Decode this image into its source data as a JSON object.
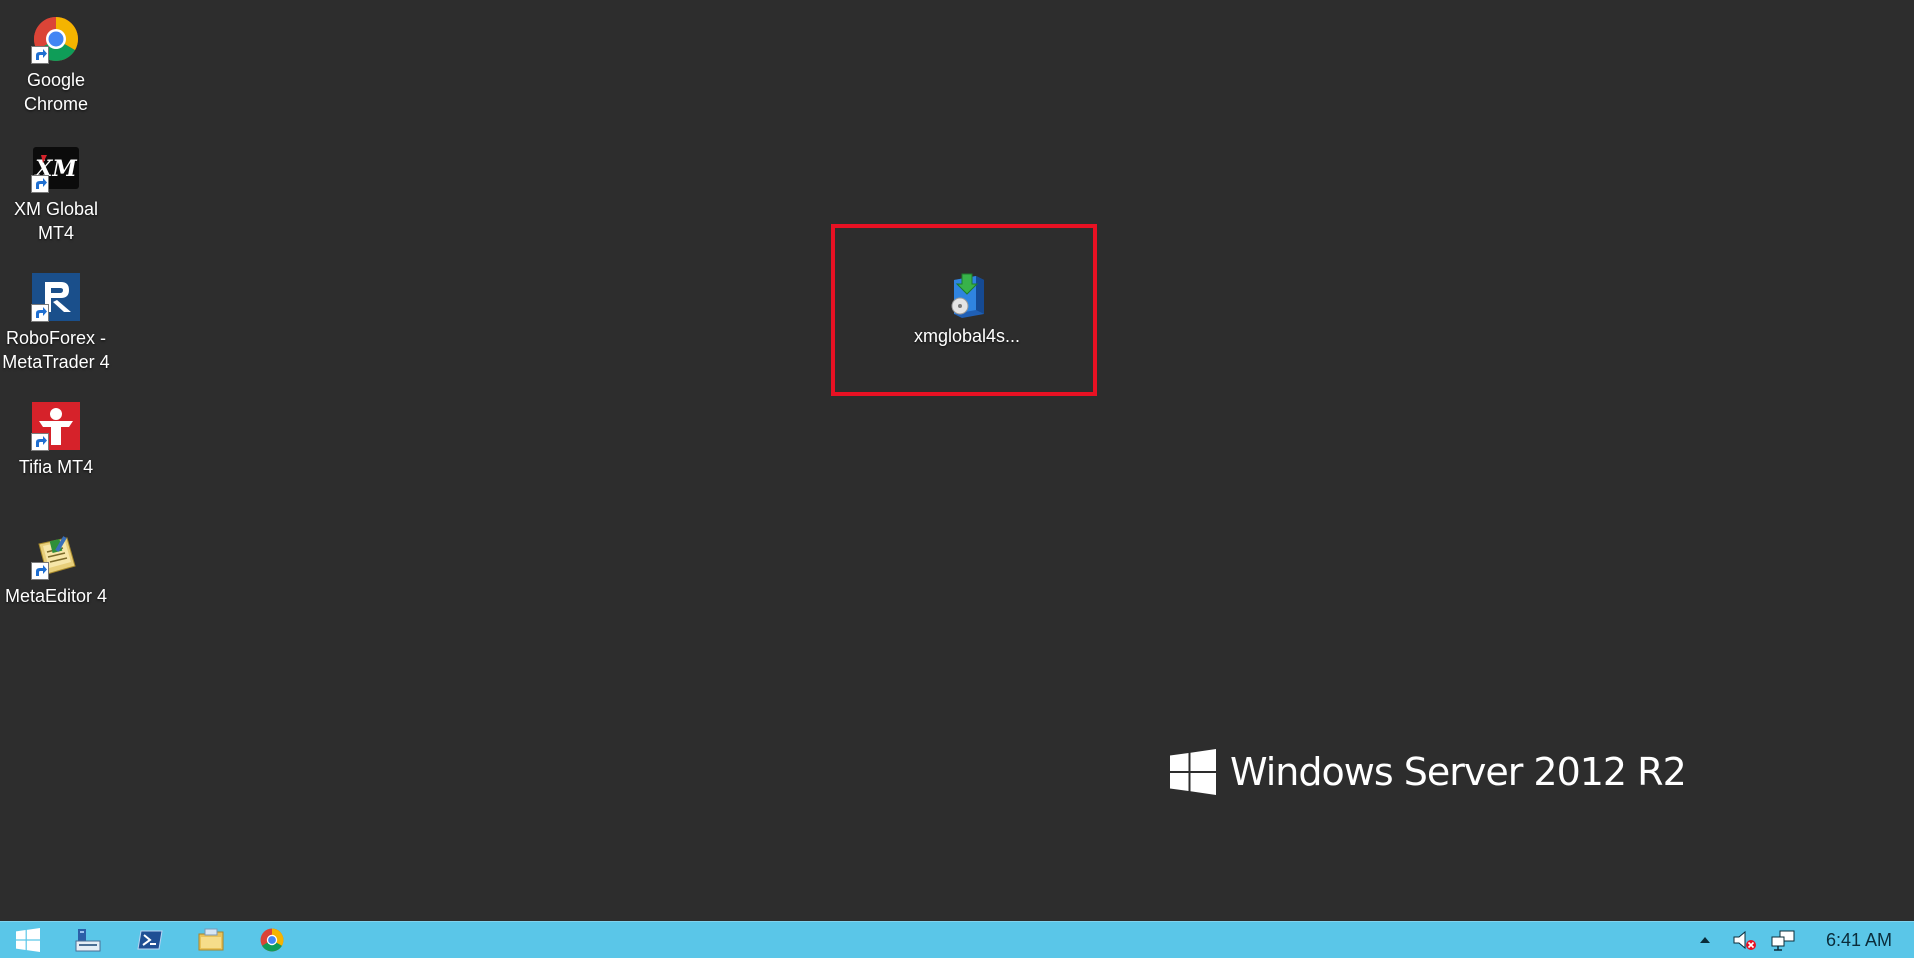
{
  "desktop": {
    "icons": [
      {
        "label_line1": "Google",
        "label_line2": "Chrome",
        "icon": "chrome-icon"
      },
      {
        "label_line1": "XM Global",
        "label_line2": "MT4",
        "icon": "xm-icon"
      },
      {
        "label_line1": "RoboForex -",
        "label_line2": "MetaTrader 4",
        "icon": "roboforex-icon"
      },
      {
        "label_line1": "Tifia MT4",
        "label_line2": "",
        "icon": "tifia-icon"
      },
      {
        "label_line1": "MetaEditor 4",
        "label_line2": "",
        "icon": "metaeditor-icon"
      }
    ],
    "installer": {
      "label": "xmglobal4s...",
      "icon": "installer-icon"
    },
    "brand": {
      "text": "Windows Server 2012 R2"
    }
  },
  "colors": {
    "desktop_bg": "#2d2d2d",
    "taskbar_bg": "#5ac6e8",
    "highlight": "#e81123"
  },
  "taskbar": {
    "pinned": [
      {
        "icon": "start-icon"
      },
      {
        "icon": "server-manager-icon"
      },
      {
        "icon": "powershell-icon"
      },
      {
        "icon": "file-explorer-icon"
      },
      {
        "icon": "chrome-icon"
      }
    ],
    "tray": {
      "clock": "6:41 AM",
      "icons": [
        "show-hidden-icons-icon",
        "volume-muted-icon",
        "network-icon"
      ]
    }
  }
}
